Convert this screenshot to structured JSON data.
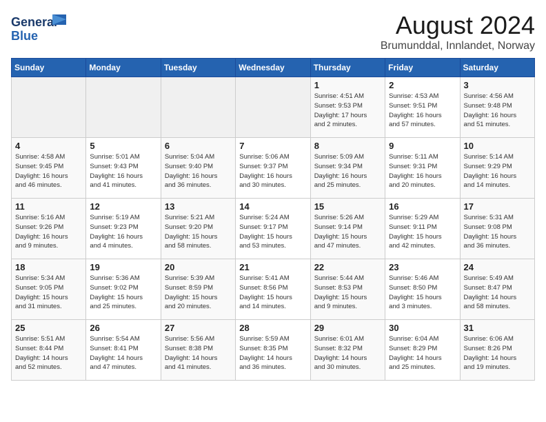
{
  "header": {
    "logo_general": "General",
    "logo_blue": "Blue",
    "month_title": "August 2024",
    "location": "Brumunddal, Innlandet, Norway"
  },
  "weekdays": [
    "Sunday",
    "Monday",
    "Tuesday",
    "Wednesday",
    "Thursday",
    "Friday",
    "Saturday"
  ],
  "weeks": [
    [
      {
        "num": "",
        "info": ""
      },
      {
        "num": "",
        "info": ""
      },
      {
        "num": "",
        "info": ""
      },
      {
        "num": "",
        "info": ""
      },
      {
        "num": "1",
        "info": "Sunrise: 4:51 AM\nSunset: 9:53 PM\nDaylight: 17 hours\nand 2 minutes."
      },
      {
        "num": "2",
        "info": "Sunrise: 4:53 AM\nSunset: 9:51 PM\nDaylight: 16 hours\nand 57 minutes."
      },
      {
        "num": "3",
        "info": "Sunrise: 4:56 AM\nSunset: 9:48 PM\nDaylight: 16 hours\nand 51 minutes."
      }
    ],
    [
      {
        "num": "4",
        "info": "Sunrise: 4:58 AM\nSunset: 9:45 PM\nDaylight: 16 hours\nand 46 minutes."
      },
      {
        "num": "5",
        "info": "Sunrise: 5:01 AM\nSunset: 9:43 PM\nDaylight: 16 hours\nand 41 minutes."
      },
      {
        "num": "6",
        "info": "Sunrise: 5:04 AM\nSunset: 9:40 PM\nDaylight: 16 hours\nand 36 minutes."
      },
      {
        "num": "7",
        "info": "Sunrise: 5:06 AM\nSunset: 9:37 PM\nDaylight: 16 hours\nand 30 minutes."
      },
      {
        "num": "8",
        "info": "Sunrise: 5:09 AM\nSunset: 9:34 PM\nDaylight: 16 hours\nand 25 minutes."
      },
      {
        "num": "9",
        "info": "Sunrise: 5:11 AM\nSunset: 9:31 PM\nDaylight: 16 hours\nand 20 minutes."
      },
      {
        "num": "10",
        "info": "Sunrise: 5:14 AM\nSunset: 9:29 PM\nDaylight: 16 hours\nand 14 minutes."
      }
    ],
    [
      {
        "num": "11",
        "info": "Sunrise: 5:16 AM\nSunset: 9:26 PM\nDaylight: 16 hours\nand 9 minutes."
      },
      {
        "num": "12",
        "info": "Sunrise: 5:19 AM\nSunset: 9:23 PM\nDaylight: 16 hours\nand 4 minutes."
      },
      {
        "num": "13",
        "info": "Sunrise: 5:21 AM\nSunset: 9:20 PM\nDaylight: 15 hours\nand 58 minutes."
      },
      {
        "num": "14",
        "info": "Sunrise: 5:24 AM\nSunset: 9:17 PM\nDaylight: 15 hours\nand 53 minutes."
      },
      {
        "num": "15",
        "info": "Sunrise: 5:26 AM\nSunset: 9:14 PM\nDaylight: 15 hours\nand 47 minutes."
      },
      {
        "num": "16",
        "info": "Sunrise: 5:29 AM\nSunset: 9:11 PM\nDaylight: 15 hours\nand 42 minutes."
      },
      {
        "num": "17",
        "info": "Sunrise: 5:31 AM\nSunset: 9:08 PM\nDaylight: 15 hours\nand 36 minutes."
      }
    ],
    [
      {
        "num": "18",
        "info": "Sunrise: 5:34 AM\nSunset: 9:05 PM\nDaylight: 15 hours\nand 31 minutes."
      },
      {
        "num": "19",
        "info": "Sunrise: 5:36 AM\nSunset: 9:02 PM\nDaylight: 15 hours\nand 25 minutes."
      },
      {
        "num": "20",
        "info": "Sunrise: 5:39 AM\nSunset: 8:59 PM\nDaylight: 15 hours\nand 20 minutes."
      },
      {
        "num": "21",
        "info": "Sunrise: 5:41 AM\nSunset: 8:56 PM\nDaylight: 15 hours\nand 14 minutes."
      },
      {
        "num": "22",
        "info": "Sunrise: 5:44 AM\nSunset: 8:53 PM\nDaylight: 15 hours\nand 9 minutes."
      },
      {
        "num": "23",
        "info": "Sunrise: 5:46 AM\nSunset: 8:50 PM\nDaylight: 15 hours\nand 3 minutes."
      },
      {
        "num": "24",
        "info": "Sunrise: 5:49 AM\nSunset: 8:47 PM\nDaylight: 14 hours\nand 58 minutes."
      }
    ],
    [
      {
        "num": "25",
        "info": "Sunrise: 5:51 AM\nSunset: 8:44 PM\nDaylight: 14 hours\nand 52 minutes."
      },
      {
        "num": "26",
        "info": "Sunrise: 5:54 AM\nSunset: 8:41 PM\nDaylight: 14 hours\nand 47 minutes."
      },
      {
        "num": "27",
        "info": "Sunrise: 5:56 AM\nSunset: 8:38 PM\nDaylight: 14 hours\nand 41 minutes."
      },
      {
        "num": "28",
        "info": "Sunrise: 5:59 AM\nSunset: 8:35 PM\nDaylight: 14 hours\nand 36 minutes."
      },
      {
        "num": "29",
        "info": "Sunrise: 6:01 AM\nSunset: 8:32 PM\nDaylight: 14 hours\nand 30 minutes."
      },
      {
        "num": "30",
        "info": "Sunrise: 6:04 AM\nSunset: 8:29 PM\nDaylight: 14 hours\nand 25 minutes."
      },
      {
        "num": "31",
        "info": "Sunrise: 6:06 AM\nSunset: 8:26 PM\nDaylight: 14 hours\nand 19 minutes."
      }
    ]
  ]
}
